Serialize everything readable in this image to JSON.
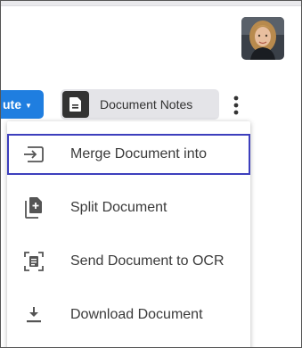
{
  "toolbar": {
    "route_button_label": "ute",
    "document_notes_label": "Document Notes"
  },
  "menu": {
    "items": [
      {
        "label": "Merge Document into",
        "icon": "merge-icon",
        "highlighted": true
      },
      {
        "label": "Split Document",
        "icon": "split-document-icon",
        "highlighted": false
      },
      {
        "label": "Send Document to OCR",
        "icon": "ocr-icon",
        "highlighted": false
      },
      {
        "label": "Download Document",
        "icon": "download-icon",
        "highlighted": false
      }
    ]
  },
  "colors": {
    "route_button": "#1f7ee0",
    "highlight_outline": "#3d3fbd",
    "notes_button_bg": "#e4e4e8",
    "icon_dark": "#333333"
  }
}
